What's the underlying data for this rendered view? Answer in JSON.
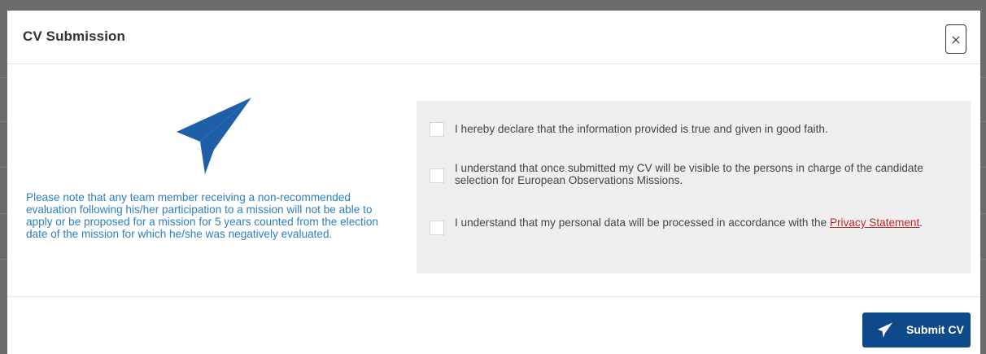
{
  "modal": {
    "title": "CV Submission",
    "close_label": "×"
  },
  "notice": {
    "text": "Please note that any team member receiving a non-recommended evaluation following his/her participation to a mission will not be able to apply or be proposed for a mission for 5 years counted from the election date of the mission for which he/she was negatively evaluated."
  },
  "declarations": {
    "items": [
      {
        "text": "I hereby declare that the information provided is true and given in good faith.",
        "checked": false
      },
      {
        "text": "I understand that once submitted my CV will be visible to the persons in charge of the candidate selection for European Observations Missions.",
        "checked": false
      },
      {
        "text_before_link": "I understand that my personal data will be processed in accordance with the ",
        "link_text": "Privacy Statement",
        "text_after_link": ".",
        "checked": false
      }
    ]
  },
  "footer": {
    "submit_label": "Submit CV"
  },
  "colors": {
    "accent": "#0e4a8a",
    "plane_icon": "#1f5fa8",
    "notice_text": "#2d7fc1",
    "link": "#c0272d",
    "panel_bg": "#efefef",
    "backdrop": "#6b6b6b"
  },
  "icons": {
    "close": "close-icon",
    "hero": "paper-plane-icon",
    "submit": "paper-plane-icon"
  }
}
